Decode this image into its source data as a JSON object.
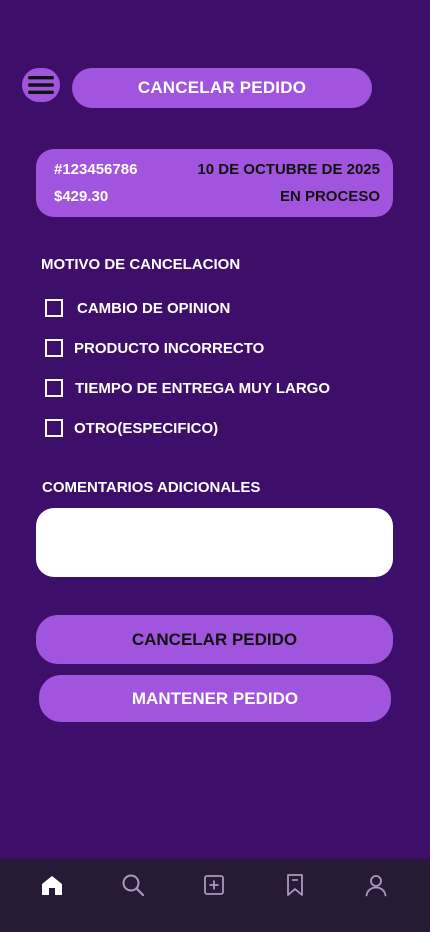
{
  "header": {
    "title": "CANCELAR PEDIDO",
    "menu_icon": "hamburger-menu-icon"
  },
  "order": {
    "id": "#123456786",
    "date": "10 DE OCTUBRE DE 2025",
    "price": "$429.30",
    "status": "EN PROCESO"
  },
  "reason": {
    "label": "MOTIVO DE CANCELACION",
    "options": [
      {
        "label": "CAMBIO DE OPINION",
        "checked": false
      },
      {
        "label": "PRODUCTO INCORRECTO",
        "checked": false
      },
      {
        "label": "TIEMPO DE ENTREGA MUY LARGO",
        "checked": false
      },
      {
        "label": "OTRO(ESPECIFICO)",
        "checked": false
      }
    ]
  },
  "comments": {
    "label": "COMENTARIOS ADICIONALES",
    "value": ""
  },
  "actions": {
    "cancel_label": "CANCELAR PEDIDO",
    "keep_label": "MANTENER PEDIDO"
  },
  "nav": {
    "items": [
      {
        "icon": "home-icon",
        "active": true
      },
      {
        "icon": "search-icon",
        "active": false
      },
      {
        "icon": "add-square-icon",
        "active": false
      },
      {
        "icon": "bookmark-icon",
        "active": false
      },
      {
        "icon": "user-icon",
        "active": false
      }
    ]
  },
  "colors": {
    "background": "#3d0f6b",
    "accent": "#a155df",
    "nav_background": "#261a37",
    "nav_icon": "#a89ab8",
    "nav_icon_active": "#ffffff"
  }
}
